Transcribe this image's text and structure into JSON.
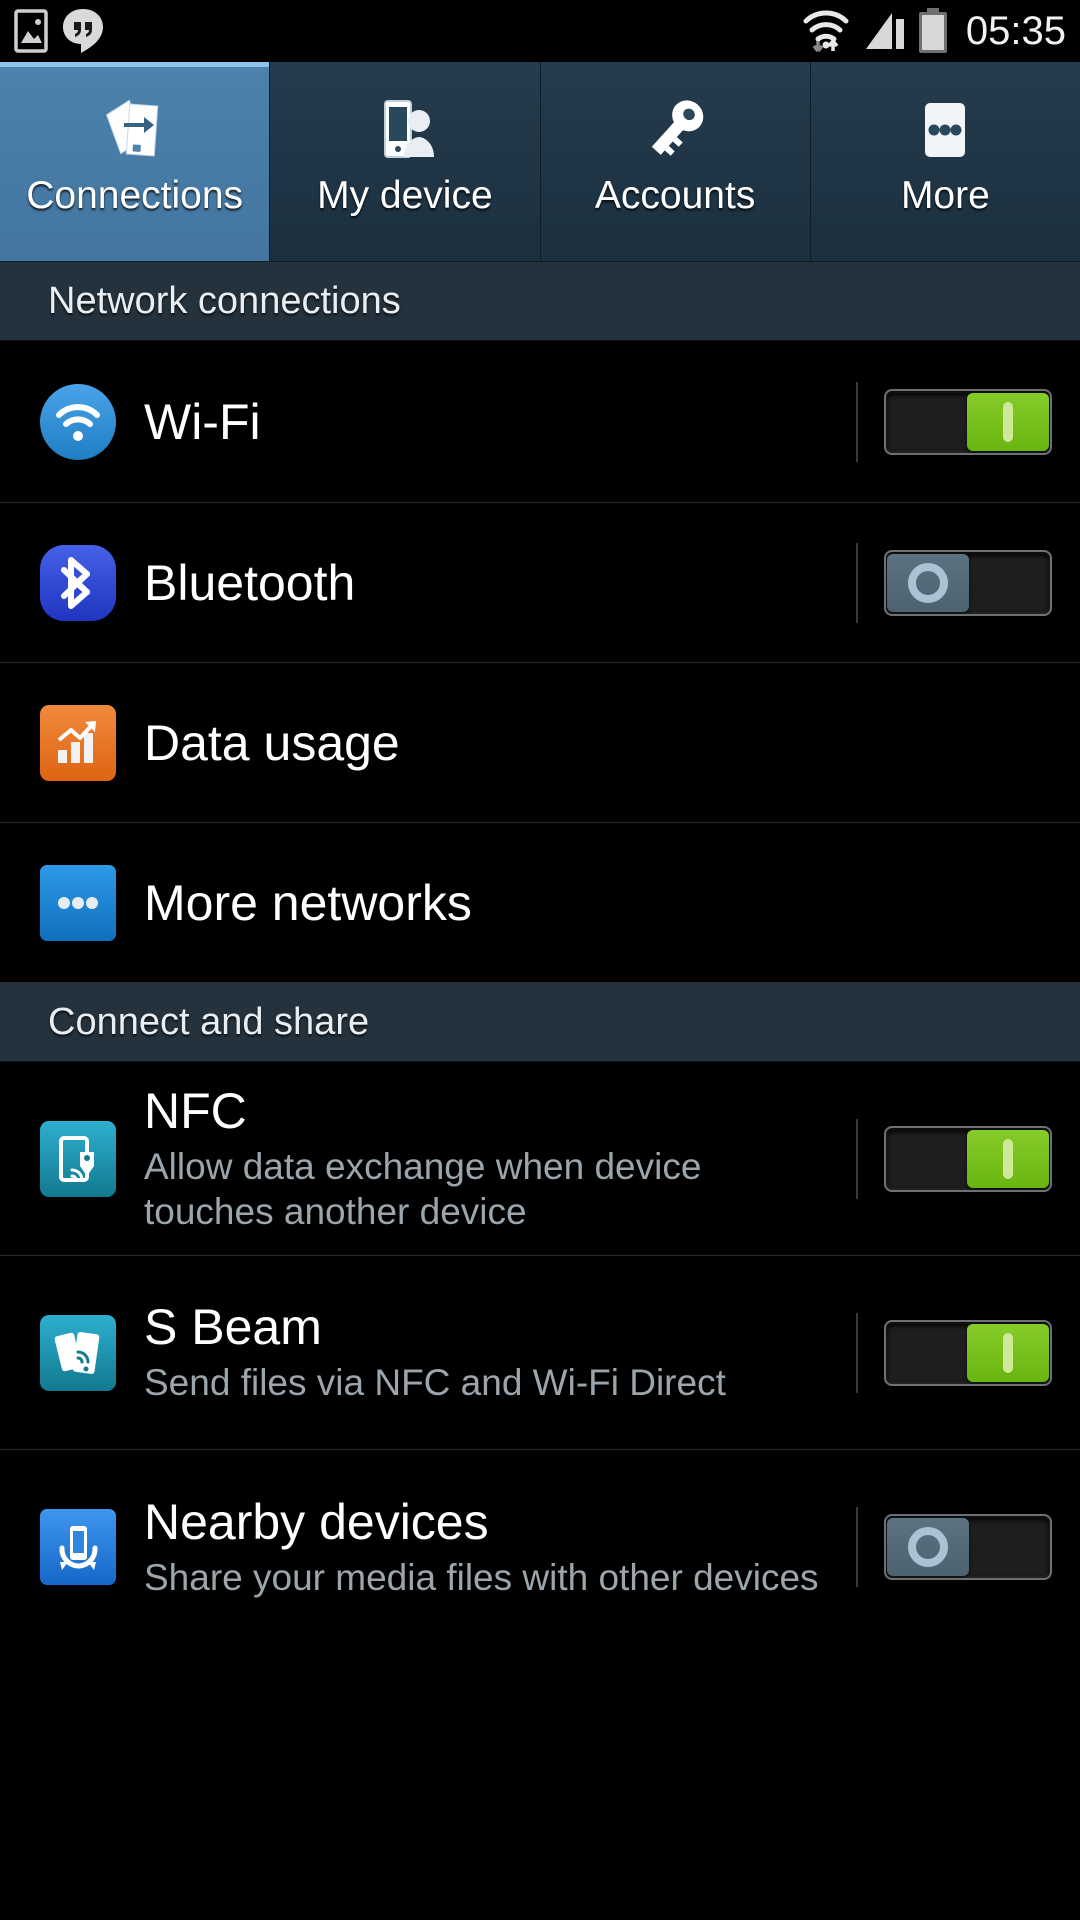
{
  "status_bar": {
    "icons_left": [
      "gallery-image-icon",
      "hangouts-message-icon"
    ],
    "icons_right": [
      "wifi-signal-icon",
      "cellular-signal-icon",
      "battery-icon"
    ],
    "clock": "05:35"
  },
  "tabs": [
    {
      "label": "Connections",
      "icon": "connections-icon",
      "selected": true
    },
    {
      "label": "My device",
      "icon": "my-device-icon",
      "selected": false
    },
    {
      "label": "Accounts",
      "icon": "accounts-key-icon",
      "selected": false
    },
    {
      "label": "More",
      "icon": "more-dots-icon",
      "selected": false
    }
  ],
  "sections": [
    {
      "header": "Network connections",
      "rows": [
        {
          "title": "Wi-Fi",
          "subtitle": "",
          "icon": "wifi-icon",
          "icon_color": "#2f8fd8",
          "toggle": "on"
        },
        {
          "title": "Bluetooth",
          "subtitle": "",
          "icon": "bluetooth-icon",
          "icon_color": "#2b4fd4",
          "toggle": "off"
        },
        {
          "title": "Data usage",
          "subtitle": "",
          "icon": "data-usage-icon",
          "icon_color": "#e8722a",
          "toggle": "none"
        },
        {
          "title": "More networks",
          "subtitle": "",
          "icon": "more-networks-icon",
          "icon_color": "#1a86d8",
          "toggle": "none"
        }
      ]
    },
    {
      "header": "Connect and share",
      "rows": [
        {
          "title": "NFC",
          "subtitle": "Allow data exchange when device touches another device",
          "icon": "nfc-icon",
          "icon_color": "#1b8fae",
          "toggle": "on"
        },
        {
          "title": "S Beam",
          "subtitle": "Send files via NFC and Wi-Fi Direct",
          "icon": "s-beam-icon",
          "icon_color": "#1b8fae",
          "toggle": "on"
        },
        {
          "title": "Nearby devices",
          "subtitle": "Share your media files with other devices",
          "icon": "nearby-devices-icon",
          "icon_color": "#2f86e0",
          "toggle": "off"
        }
      ]
    }
  ],
  "colors": {
    "accent_selected_tab": "#4c82ad",
    "section_header_bg": "#24323d",
    "toggle_on": "#76c219",
    "toggle_off": "#5d7280",
    "page_bg": "#000000"
  }
}
